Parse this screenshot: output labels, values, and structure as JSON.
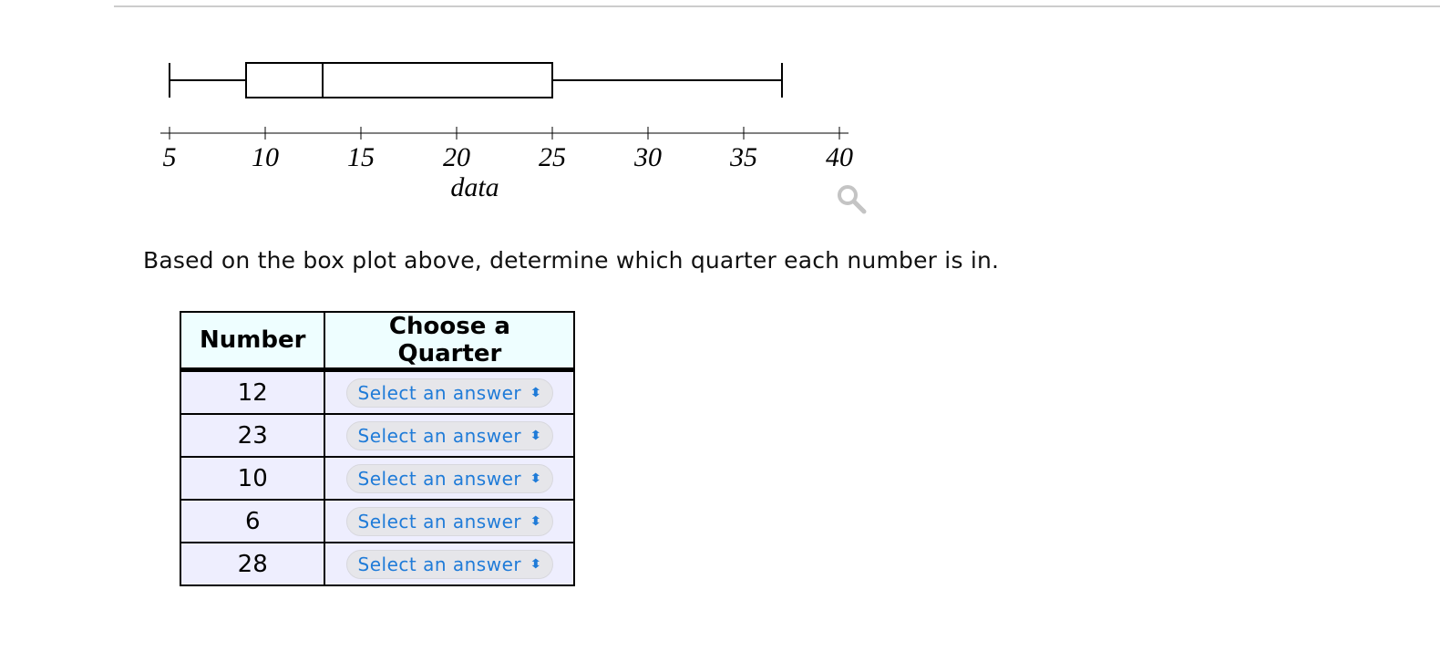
{
  "chart_data": {
    "type": "boxplot",
    "title": "",
    "xlabel": "data",
    "ylabel": "",
    "xlim": [
      5,
      40
    ],
    "xticks": [
      5,
      10,
      15,
      20,
      25,
      30,
      35,
      40
    ],
    "xtick_labels": [
      "5",
      "10",
      "15",
      "20",
      "25",
      "30",
      "35",
      "40"
    ],
    "grid": false,
    "box": {
      "min": 5,
      "q1": 9,
      "median": 13,
      "q3": 25,
      "max": 37
    }
  },
  "icons": {
    "zoom": "magnifier-icon"
  },
  "question": "Based on the box plot above, determine which quarter each number is in.",
  "table": {
    "headers": [
      "Number",
      "Choose a Quarter"
    ],
    "rows": [
      {
        "number": "12",
        "answer": "Select an answer"
      },
      {
        "number": "23",
        "answer": "Select an answer"
      },
      {
        "number": "10",
        "answer": "Select an answer"
      },
      {
        "number": "6",
        "answer": "Select an answer"
      },
      {
        "number": "28",
        "answer": "Select an answer"
      }
    ]
  },
  "colors": {
    "select_text": "#1f7bd8",
    "header_bg": "#eefeff",
    "row_bg": "#eeeefe"
  }
}
